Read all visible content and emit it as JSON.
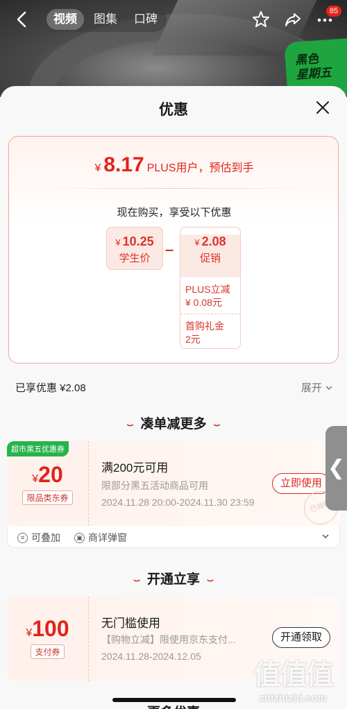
{
  "nav": {
    "tabs": [
      "视频",
      "图集",
      "口碑"
    ],
    "active_tab": "视频",
    "cart_count": "85",
    "promo_badge_line1": "黑色",
    "promo_badge_line2": "星期五"
  },
  "sheet": {
    "title": "优惠",
    "final_price_currency": "¥",
    "final_price": "8.17",
    "final_desc": "PLUS用户，预估到手",
    "subtitle": "现在购买，享受以下优惠",
    "base_price_currency": "¥",
    "base_price": "10.25",
    "base_label": "学生价",
    "minus": "–",
    "promo_currency": "¥",
    "promo_amount": "2.08",
    "promo_label": "促销",
    "promo_items": [
      "PLUS立减\n¥ 0.08元",
      "首购礼金\n2元"
    ],
    "enjoyed": "已享优惠 ¥2.08",
    "expand": "展开"
  },
  "section1": {
    "title": "凑单减更多",
    "coupon": {
      "corner": "超市黑五优惠券",
      "currency": "¥",
      "amount": "20",
      "type": "限品类东券",
      "title": "满200元可用",
      "desc": "限部分黑五活动商品可用",
      "date": "2024.11.28 20:00-2024.11.30 23:59",
      "button": "立即使用",
      "stamp": "已领取"
    },
    "footer_stackable": "可叠加",
    "footer_detail": "商详弹窗"
  },
  "section2": {
    "title": "开通立享",
    "coupon": {
      "currency": "¥",
      "amount": "100",
      "type": "支付券",
      "title": "无门槛使用",
      "desc": "【购物立减】限使用京东支付...",
      "date": "2024.11.28-2024.12.05",
      "button": "开通领取"
    }
  },
  "section3": {
    "title": "更多优惠"
  },
  "watermark": {
    "logo": "值值值",
    "url": "zhizhizhi.com"
  },
  "colors": {
    "accent": "#e2231a",
    "green": "#27b34b"
  }
}
